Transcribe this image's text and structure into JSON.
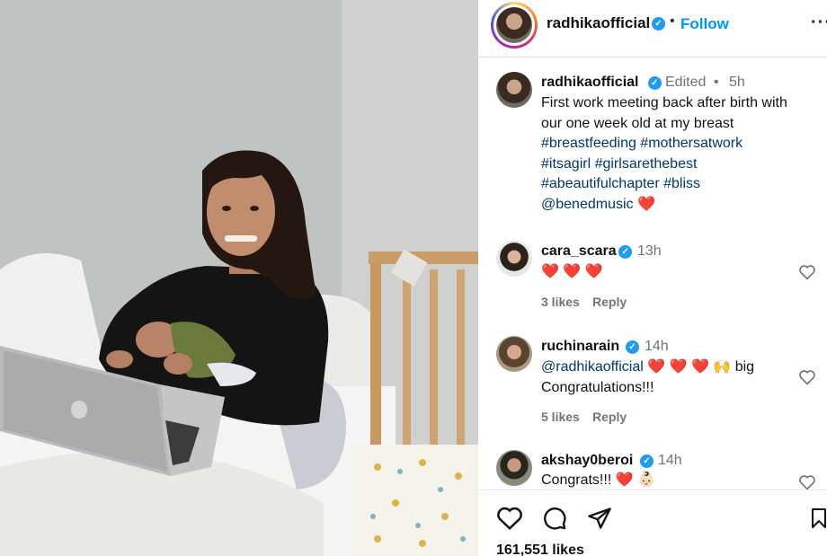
{
  "post": {
    "image_alt_icon": "photo-of-mother-with-newborn-and-laptop",
    "username": "radhikaofficial",
    "follow_label": "Follow",
    "dot": "•",
    "more_icon": "more-options-icon",
    "caption": {
      "username": "radhikaofficial",
      "edited": "Edited",
      "dot": "•",
      "time": "5h",
      "text_line1": "First work meeting back after birth with",
      "text_line2": "our one week old at my breast",
      "hashtags_line1": "#breastfeeding #mothersatwork",
      "hashtags_line2": "#itsagirl #girlsarethebest",
      "hashtags_line3": "#abeautifulchapter #bliss",
      "mention": "@benedmusic",
      "emoji": "❤️"
    },
    "comments": [
      {
        "username": "cara_scara",
        "time": "13h",
        "text": "❤️ ❤️ ❤️",
        "likes": "3 likes",
        "reply": "Reply"
      },
      {
        "username": "ruchinarain",
        "time": "14h",
        "mention": "@radhikaofficial",
        "text_after": "❤️ ❤️ ❤️ 🙌 big",
        "text_line2": "Congratulations!!!",
        "likes": "5 likes",
        "reply": "Reply"
      },
      {
        "username": "akshay0beroi",
        "time": "14h",
        "text": "Congrats!!! ❤️ 👶🏻"
      }
    ],
    "likes_total": "161,551 likes"
  },
  "colors": {
    "accent": "#0095f6",
    "verified": "#1f9bf0",
    "hashtag": "#00376b",
    "muted": "#737373"
  }
}
